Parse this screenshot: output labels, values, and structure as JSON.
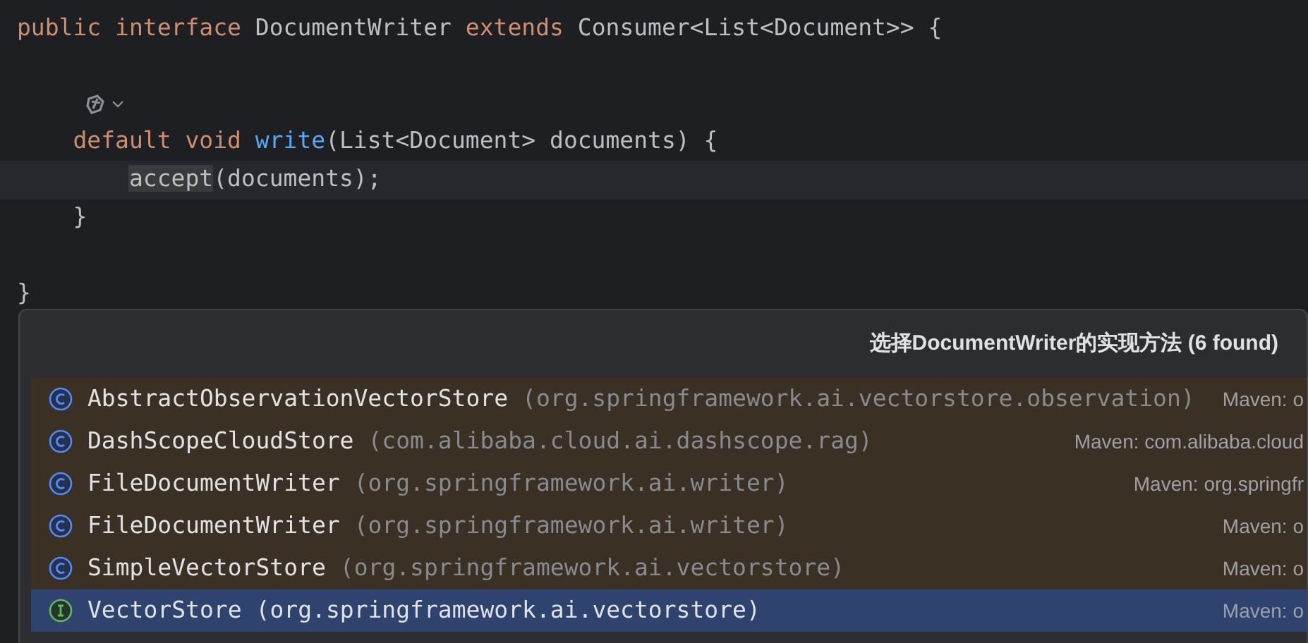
{
  "editor": {
    "lines": [
      {
        "tokens": [
          {
            "kind": "keyword",
            "text": "public interface "
          },
          {
            "kind": "plain",
            "text": "DocumentWriter "
          },
          {
            "kind": "keyword",
            "text": "extends "
          },
          {
            "kind": "plain",
            "text": "Consumer<List<Document>> {"
          }
        ]
      },
      {
        "kind": "blank"
      },
      {
        "kind": "ai-gutter"
      },
      {
        "tokens": [
          {
            "kind": "keyword",
            "text": "    default void "
          },
          {
            "kind": "method",
            "text": "write"
          },
          {
            "kind": "plain",
            "text": "(List<Document> documents) {"
          }
        ]
      },
      {
        "current": true,
        "tokens": [
          {
            "kind": "usage",
            "text": "        accept"
          },
          {
            "kind": "plain",
            "text": "(documents);"
          }
        ]
      },
      {
        "tokens": [
          {
            "kind": "plain",
            "text": "    }"
          }
        ]
      },
      {
        "kind": "blank"
      },
      {
        "tokens": [
          {
            "kind": "plain",
            "text": "}"
          }
        ]
      }
    ]
  },
  "popup": {
    "title": "选择DocumentWriter的实现方法 (6 found)",
    "items": [
      {
        "kind": "class",
        "name": "AbstractObservationVectorStore",
        "package": "(org.springframework.ai.vectorstore.observation)",
        "source": "Maven: o",
        "selected": false
      },
      {
        "kind": "class",
        "name": "DashScopeCloudStore",
        "package": "(com.alibaba.cloud.ai.dashscope.rag)",
        "source": "Maven: com.alibaba.cloud",
        "selected": false
      },
      {
        "kind": "class",
        "name": "FileDocumentWriter",
        "package": "(org.springframework.ai.writer)",
        "source": "Maven: org.springfr",
        "selected": false
      },
      {
        "kind": "class",
        "name": "FileDocumentWriter",
        "package": "(org.springframework.ai.writer)",
        "source": "Maven: o",
        "selected": false
      },
      {
        "kind": "class",
        "name": "SimpleVectorStore",
        "package": "(org.springframework.ai.vectorstore)",
        "source": "Maven: o",
        "selected": false
      },
      {
        "kind": "interface",
        "name": "VectorStore",
        "package": "(org.springframework.ai.vectorstore)",
        "source": "Maven: o",
        "selected": true
      }
    ]
  }
}
